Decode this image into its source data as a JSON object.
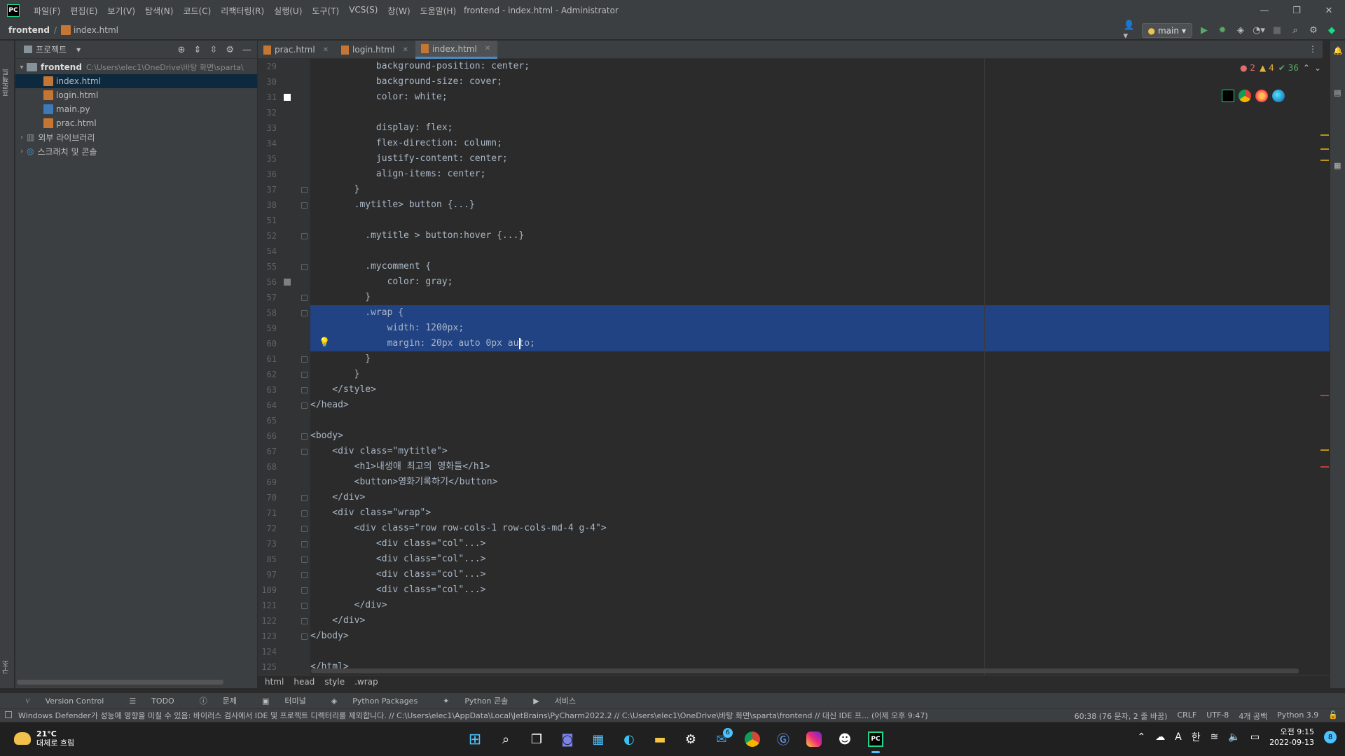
{
  "titlebar": {
    "menu": [
      "파일(F)",
      "편집(E)",
      "보기(V)",
      "탐색(N)",
      "코드(C)",
      "리팩터링(R)",
      "실행(U)",
      "도구(T)",
      "VCS(S)",
      "창(W)",
      "도움말(H)"
    ],
    "window_title": "frontend - index.html - Administrator",
    "app_badge": "PC"
  },
  "navbar": {
    "project": "frontend",
    "file": "index.html",
    "run_config": "main"
  },
  "project_panel": {
    "title": "프로젝트",
    "root_name": "frontend",
    "root_path": "C:\\Users\\elec1\\OneDrive\\바탕 화면\\sparta\\",
    "files": [
      "index.html",
      "login.html",
      "main.py",
      "prac.html"
    ],
    "external_libs": "외부 라이브러리",
    "scratches": "스크래치 및 콘솔"
  },
  "left_strip": {
    "top_tab": "프로젝트",
    "mid_tab": "구조",
    "bottom_tab": "북마크"
  },
  "tabs": [
    {
      "label": "prac.html",
      "active": false
    },
    {
      "label": "login.html",
      "active": false
    },
    {
      "label": "index.html",
      "active": true
    }
  ],
  "inspections": {
    "errors": "2",
    "warnings": "4",
    "ok": "36"
  },
  "editor": {
    "lines": [
      {
        "n": "29",
        "html": "            background-position: center;"
      },
      {
        "n": "30",
        "html": "            background-size: cover;"
      },
      {
        "n": "31",
        "html": "            color: white;"
      },
      {
        "n": "32",
        "html": ""
      },
      {
        "n": "33",
        "html": "            display: flex;"
      },
      {
        "n": "34",
        "html": "            flex-direction: column;"
      },
      {
        "n": "35",
        "html": "            justify-content: center;"
      },
      {
        "n": "36",
        "html": "            align-items: center;"
      },
      {
        "n": "37",
        "html": "        }"
      },
      {
        "n": "38",
        "html": "        .mytitle> button {...}"
      },
      {
        "n": "51",
        "html": ""
      },
      {
        "n": "52",
        "html": "          .mytitle > button:hover {...}"
      },
      {
        "n": "54",
        "html": ""
      },
      {
        "n": "55",
        "html": "          .mycomment {"
      },
      {
        "n": "56",
        "html": "              color: gray;"
      },
      {
        "n": "57",
        "html": "          }"
      },
      {
        "n": "58",
        "html": "          .wrap {"
      },
      {
        "n": "59",
        "html": "              width: 1200px;"
      },
      {
        "n": "60",
        "html": "              margin: 20px auto 0px auto;"
      },
      {
        "n": "61",
        "html": "          }"
      },
      {
        "n": "62",
        "html": "        }"
      },
      {
        "n": "63",
        "html": "    </style>"
      },
      {
        "n": "64",
        "html": "</head>"
      },
      {
        "n": "65",
        "html": ""
      },
      {
        "n": "66",
        "html": "<body>"
      },
      {
        "n": "67",
        "html": "    <div class=\"mytitle\">"
      },
      {
        "n": "68",
        "html": "        <h1>내생애 최고의 영화들</h1>"
      },
      {
        "n": "69",
        "html": "        <button>영화기록하기</button>"
      },
      {
        "n": "70",
        "html": "    </div>"
      },
      {
        "n": "71",
        "html": "    <div class=\"wrap\">"
      },
      {
        "n": "72",
        "html": "        <div class=\"row row-cols-1 row-cols-md-4 g-4\">"
      },
      {
        "n": "73",
        "html": "            <div class=\"col\"...>"
      },
      {
        "n": "85",
        "html": "            <div class=\"col\"...>"
      },
      {
        "n": "97",
        "html": "            <div class=\"col\"...>"
      },
      {
        "n": "109",
        "html": "            <div class=\"col\"...>"
      },
      {
        "n": "121",
        "html": "        </div>"
      },
      {
        "n": "122",
        "html": "    </div>"
      },
      {
        "n": "123",
        "html": "</body>"
      },
      {
        "n": "124",
        "html": ""
      },
      {
        "n": "125",
        "html": "</html>"
      }
    ]
  },
  "breadcrumb": [
    "html",
    "head",
    "style",
    ".wrap"
  ],
  "bottom_tabs": [
    "Version Control",
    "TODO",
    "문제",
    "터미널",
    "Python Packages",
    "Python 콘솔",
    "서비스"
  ],
  "statusbar": {
    "message": "Windows Defender가 성능에 영향을 미칠 수 있음: 바이러스 검사에서 IDE 및 프로젝트 디렉터리를 제외합니다. // C:\\Users\\elec1\\AppData\\Local\\JetBrains\\PyCharm2022.2 // C:\\Users\\elec1\\OneDrive\\바탕 화면\\sparta\\frontend // 대신 IDE 프... (어제 오후 9:47)",
    "position": "60:38 (76 문자, 2 줄 바꿈)",
    "line_sep": "CRLF",
    "encoding": "UTF-8",
    "indent": "4개 공백",
    "interpreter": "Python 3.9"
  },
  "taskbar": {
    "temp": "21°C",
    "weather": "대체로 흐림",
    "time": "오전 9:15",
    "date": "2022-09-13",
    "mail_badge": "6",
    "notif_count": "8",
    "ime_a": "A",
    "ime_han": "한"
  },
  "colors": {
    "accent": "#4a88c7",
    "selection": "#214283",
    "panel": "#3c3f41",
    "editor_bg": "#2b2b2b"
  }
}
